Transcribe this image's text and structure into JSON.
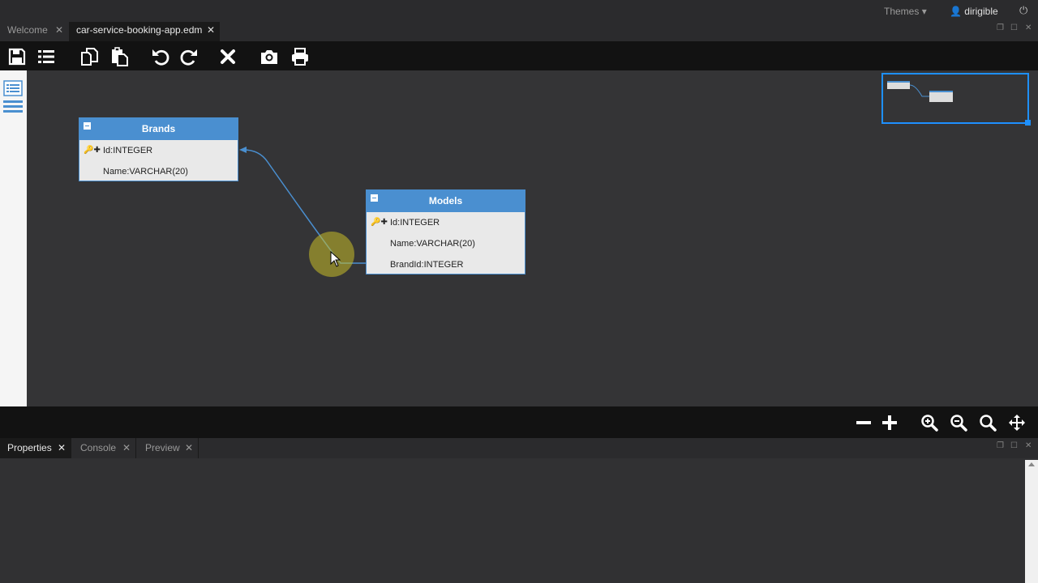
{
  "topbar": {
    "themes": "Themes",
    "user": "dirigible"
  },
  "tabs": [
    {
      "label": "Welcome",
      "close": "✕"
    },
    {
      "label": "car-service-booking-app.edm",
      "close": "✕"
    }
  ],
  "entities": {
    "brands": {
      "title": "Brands",
      "rows": [
        {
          "label": "Id:INTEGER"
        },
        {
          "label": "Name:VARCHAR(20)"
        }
      ]
    },
    "models": {
      "title": "Models",
      "rows": [
        {
          "label": "Id:INTEGER"
        },
        {
          "label": "Name:VARCHAR(20)"
        },
        {
          "label": "BrandId:INTEGER"
        }
      ]
    }
  },
  "bottom_tabs": [
    {
      "label": "Properties",
      "close": "✕"
    },
    {
      "label": "Console",
      "close": "✕"
    },
    {
      "label": "Preview",
      "close": "✕"
    }
  ],
  "colors": {
    "accent": "#4a8fd0",
    "minimap": "#1e90ff"
  }
}
